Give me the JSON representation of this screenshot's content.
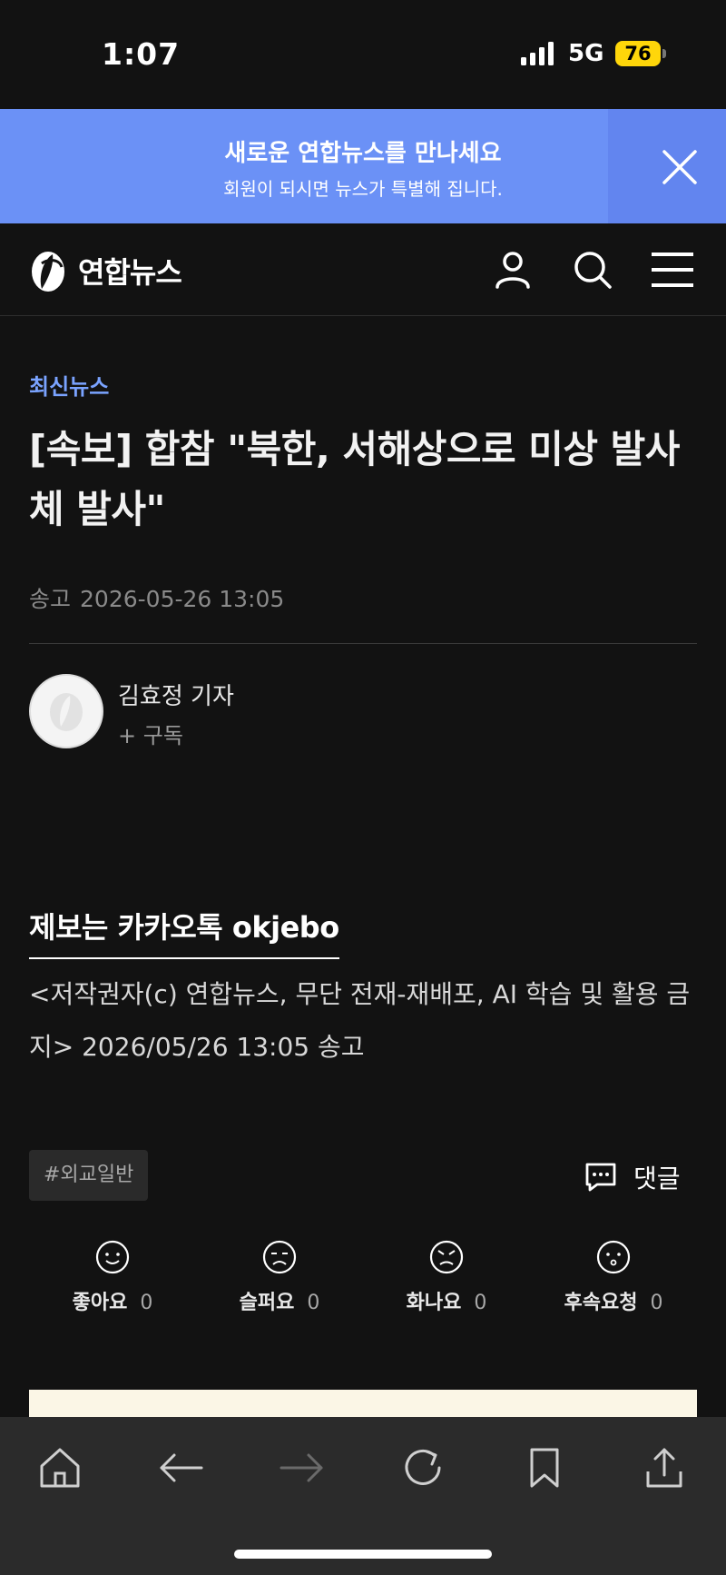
{
  "status": {
    "time": "1:07",
    "network": "5G",
    "battery": "76"
  },
  "promo": {
    "title": "새로운 연합뉴스를 만나세요",
    "subtitle": "회원이 되시면 뉴스가 특별해 집니다."
  },
  "header": {
    "logo_text": "연합뉴스"
  },
  "article": {
    "category": "최신뉴스",
    "headline": "[속보] 합참 \"북한, 서해상으로 미상 발사체 발사\"",
    "meta_label": "송고",
    "meta_datetime": "2026-05-26 13:05",
    "author_name": "김효정 기자",
    "subscribe_label": "+ 구독",
    "jebo": "제보는 카카오톡 okjebo",
    "copyright": "<저작권자(c) 연합뉴스, 무단 전재-재배포, AI 학습 및 활용 금지> 2026/05/26 13:05 송고"
  },
  "footer": {
    "tag": "#외교일반",
    "comment_label": "댓글",
    "reactions": [
      {
        "label": "좋아요",
        "count": "0"
      },
      {
        "label": "슬퍼요",
        "count": "0"
      },
      {
        "label": "화나요",
        "count": "0"
      },
      {
        "label": "후속요청",
        "count": "0"
      }
    ]
  },
  "colors": {
    "background": "#121212",
    "banner": "#6b91f6",
    "category": "#7aa3ff",
    "toolbar": "#2b2b2b",
    "battery": "#ffd60a"
  }
}
